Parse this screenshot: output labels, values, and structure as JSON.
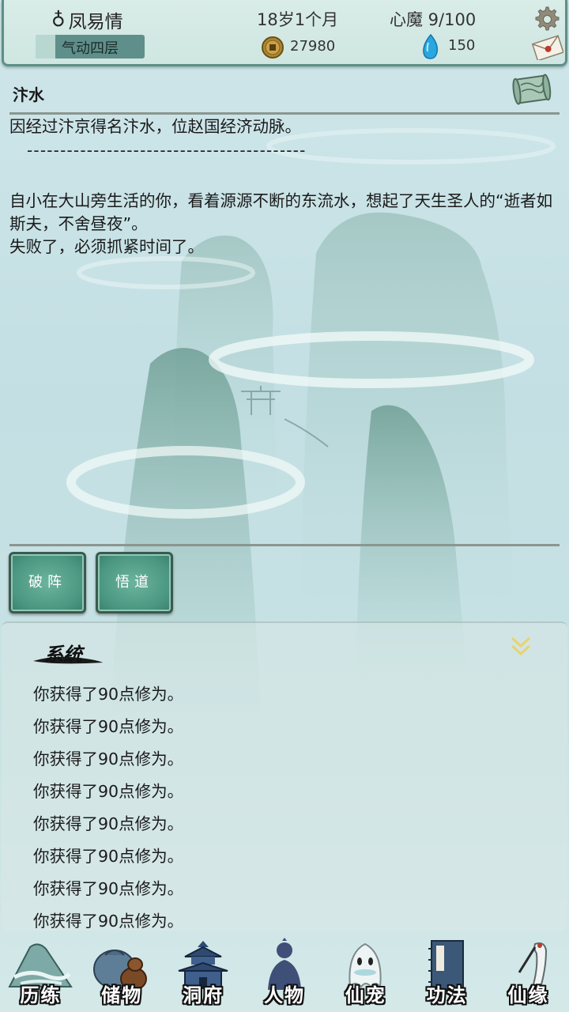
{
  "topbar": {
    "name": "凤易情",
    "gender_symbol": "♁",
    "age": "18岁1个月",
    "heart_demon": "心魔  9/100",
    "realm": "气动四层",
    "realm_progress": 0.18,
    "coins": "27980",
    "spirit_stones": "150"
  },
  "location": {
    "title": "汴水",
    "description": "因经过汴京得名汴水，位赵国经济动脉。",
    "separator": "------------------------------------------",
    "story": [
      "自小在大山旁生活的你，看着源源不断的东流水，想起了天生圣人的“逝者如斯夫，不舍昼夜”。",
      "失败了，必须抓紧时间了。"
    ]
  },
  "actions": {
    "break_formation": "破阵",
    "comprehend": "悟道"
  },
  "system_log": {
    "title": "系统",
    "entries": [
      "你获得了90点修为。",
      "你获得了90点修为。",
      "你获得了90点修为。",
      "你获得了90点修为。",
      "你获得了90点修为。",
      "你获得了90点修为。",
      "你获得了90点修为。",
      "你获得了90点修为。"
    ]
  },
  "nav": [
    {
      "label": "历练",
      "icon": "mountain-icon"
    },
    {
      "label": "储物",
      "icon": "gourd-bag-icon"
    },
    {
      "label": "洞府",
      "icon": "pagoda-icon"
    },
    {
      "label": "人物",
      "icon": "person-icon"
    },
    {
      "label": "仙宠",
      "icon": "ghost-pet-icon"
    },
    {
      "label": "功法",
      "icon": "book-icon"
    },
    {
      "label": "仙缘",
      "icon": "crane-icon"
    }
  ],
  "colors": {
    "accent_green": "#4a9680",
    "frame": "#5f8f86",
    "background": "#c8e2e4"
  }
}
